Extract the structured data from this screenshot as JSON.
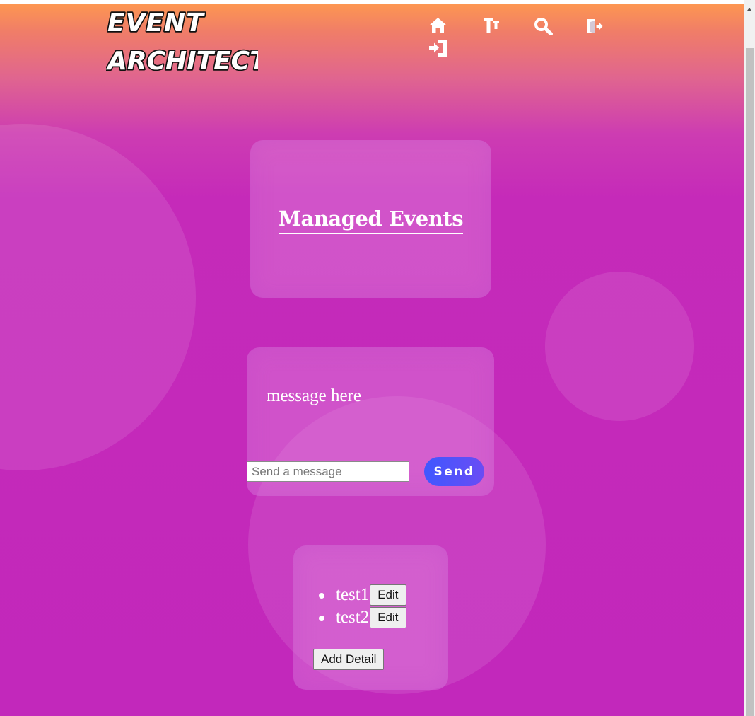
{
  "header": {
    "logo_line1": "EVENT",
    "logo_line2": "ARCHITECT",
    "nav_icons": [
      "home-icon",
      "text-size-icon",
      "search-icon",
      "logout-icon",
      "login-icon"
    ]
  },
  "managed_events": {
    "title": "Managed Events"
  },
  "messages": {
    "text": "message here",
    "input_placeholder": "Send a message",
    "send_label": "Send"
  },
  "details": {
    "items": [
      {
        "name": "test1",
        "edit_label": "Edit"
      },
      {
        "name": "test2",
        "edit_label": "Edit"
      }
    ],
    "add_label": "Add Detail"
  },
  "colors": {
    "gradient_top": "#ff9a4e",
    "gradient_bottom": "#c228bb",
    "send_button": "#4a55fb"
  }
}
